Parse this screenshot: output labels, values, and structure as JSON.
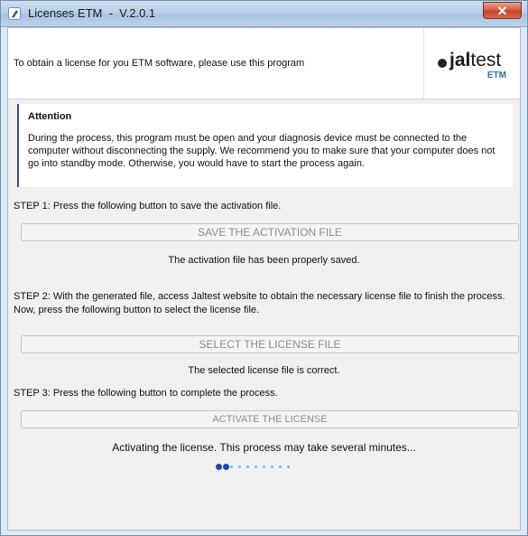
{
  "window": {
    "title": "Licenses ETM  -  V.2.0.1",
    "close_glyph": "✕"
  },
  "header": {
    "intro": "To obtain a license for you ETM software, please use this program",
    "logo_word_bold": "jal",
    "logo_word_light": "test",
    "logo_sub": "ETM"
  },
  "attention": {
    "title": "Attention",
    "body": "During the process, this program must be open and your diagnosis device must be connected to the computer without disconnecting the supply. We recommend you to make sure that your computer does not go into standby mode. Otherwise, you would have to start the process again."
  },
  "steps": [
    {
      "text": "STEP 1: Press the following button to save the activation file.",
      "button_label": "SAVE THE ACTIVATION FILE",
      "status": "The activation file has been properly saved."
    },
    {
      "text": "STEP 2: With the generated file, access Jaltest website to obtain the necessary license file to finish the process. Now, press the following button to select the license file.",
      "button_label": "SELECT THE LICENSE FILE",
      "status": "The selected license file is correct."
    },
    {
      "text": "STEP 3: Press the following button to complete the process.",
      "button_label": "ACTIVATE THE LICENSE",
      "status": "Activating the license. This process may take several minutes..."
    }
  ],
  "progress": {
    "total_dots": 10,
    "active_dots": 2,
    "active_color": "#1e4aa8",
    "inactive_color": "#7fb2e3"
  },
  "colors": {
    "accent": "#1e4aa8",
    "title_bar": "#b9d0e8",
    "close_button": "#c6402a"
  }
}
